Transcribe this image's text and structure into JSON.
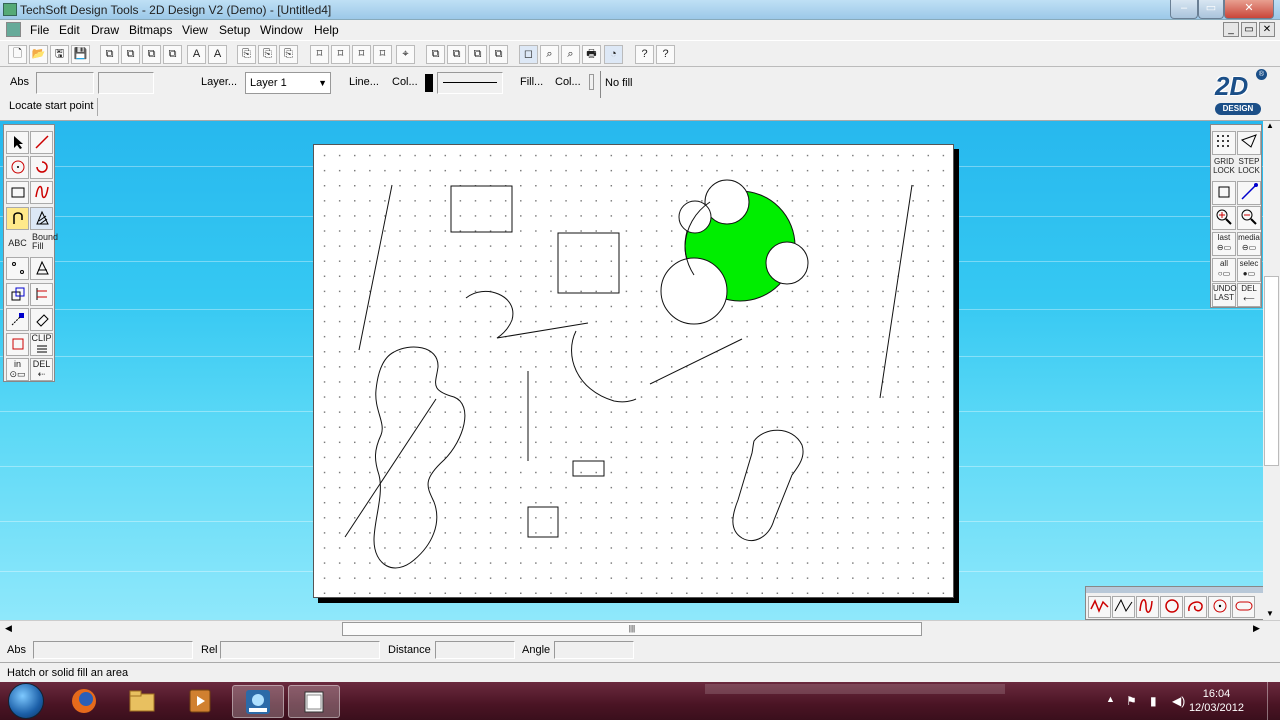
{
  "window": {
    "title": "TechSoft Design Tools - 2D Design V2 (Demo) - [Untitled4]",
    "min": "–",
    "restore": "▭",
    "close": "✕"
  },
  "menubar": {
    "items": [
      "File",
      "Edit",
      "Draw",
      "Bitmaps",
      "View",
      "Setup",
      "Window",
      "Help"
    ],
    "mdi_min": "_",
    "mdi_restore": "▭",
    "mdi_close": "✕"
  },
  "toolbar": {
    "buttons": [
      "🗋",
      "📂",
      "🖫",
      "💾",
      "⧉",
      "⧉",
      "⧉",
      "⧉",
      "A",
      "A",
      "⎘",
      "⎘",
      "⎘",
      "⌑",
      "⌑",
      "⌑",
      "⌑",
      "⌖",
      "⧉",
      "⧉",
      "⧉",
      "⧉",
      "◻",
      "⌕",
      "🖶",
      "◔",
      "?",
      "?"
    ]
  },
  "props": {
    "abs_label": "Abs",
    "layer_button": "Layer...",
    "layer_value": "Layer 1",
    "line_button": "Line...",
    "col_button_1": "Col...",
    "fill_button": "Fill...",
    "col_button_2": "Col...",
    "fill_value": "No fill",
    "prompt": "Locate start point",
    "logo_text": "2D",
    "logo_sub": "DESIGN"
  },
  "left_tools": {
    "abc": "ABC",
    "tooltip": "Bound Fill",
    "clip": "CLIP",
    "in": "in",
    "del": "DEL"
  },
  "right_tools": {
    "grid_lock": "GRID LOCK",
    "step_lock": "STEP LOCK",
    "last": "last",
    "media": "media",
    "all": "all",
    "select": "selec",
    "undo_last": "UNDO LAST",
    "del": "DEL"
  },
  "coords": {
    "abs": "Abs",
    "rel": "Rel",
    "distance": "Distance",
    "angle": "Angle"
  },
  "status": {
    "text": "Hatch or solid fill an area"
  },
  "colors": {
    "fill_green": "#00ee00",
    "workspace_top": "#27b8ee",
    "taskbar": "#4a1424"
  },
  "taskbar": {
    "time": "16:04",
    "date": "12/03/2012",
    "tray_arrow": "▲"
  }
}
